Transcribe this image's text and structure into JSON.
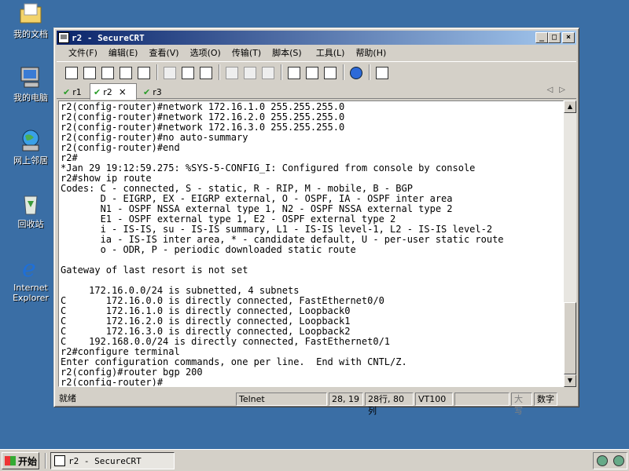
{
  "desktop": {
    "icons": [
      {
        "label": "我的文档"
      },
      {
        "label": "我的电脑"
      },
      {
        "label": "网上邻居"
      },
      {
        "label": "回收站"
      },
      {
        "label": "Internet Explorer"
      }
    ]
  },
  "window": {
    "title": "r2 - SecureCRT",
    "buttons": {
      "minimize": "_",
      "maximize": "□",
      "close": "×"
    }
  },
  "menu": [
    "文件(F)",
    "编辑(E)",
    "查看(V)",
    "选项(O)",
    "传输(T)",
    "脚本(S)",
    "工具(L)",
    "帮助(H)"
  ],
  "tabs": [
    {
      "label": "r1",
      "active": false
    },
    {
      "label": "r2",
      "active": true
    },
    {
      "label": "r3",
      "active": false
    }
  ],
  "tab_close": "×",
  "terminal_lines": [
    "r2(config-router)#network 172.16.1.0 255.255.255.0",
    "r2(config-router)#network 172.16.2.0 255.255.255.0",
    "r2(config-router)#network 172.16.3.0 255.255.255.0",
    "r2(config-router)#no auto-summary",
    "r2(config-router)#end",
    "r2#",
    "*Jan 29 19:12:59.275: %SYS-5-CONFIG_I: Configured from console by console",
    "r2#show ip route",
    "Codes: C - connected, S - static, R - RIP, M - mobile, B - BGP",
    "       D - EIGRP, EX - EIGRP external, O - OSPF, IA - OSPF inter area",
    "       N1 - OSPF NSSA external type 1, N2 - OSPF NSSA external type 2",
    "       E1 - OSPF external type 1, E2 - OSPF external type 2",
    "       i - IS-IS, su - IS-IS summary, L1 - IS-IS level-1, L2 - IS-IS level-2",
    "       ia - IS-IS inter area, * - candidate default, U - per-user static route",
    "       o - ODR, P - periodic downloaded static route",
    "",
    "Gateway of last resort is not set",
    "",
    "     172.16.0.0/24 is subnetted, 4 subnets",
    "C       172.16.0.0 is directly connected, FastEthernet0/0",
    "C       172.16.1.0 is directly connected, Loopback0",
    "C       172.16.2.0 is directly connected, Loopback1",
    "C       172.16.3.0 is directly connected, Loopback2",
    "C    192.168.0.0/24 is directly connected, FastEthernet0/1",
    "r2#configure terminal",
    "Enter configuration commands, one per line.  End with CNTL/Z.",
    "r2(config)#router bgp 200",
    "r2(config-router)#"
  ],
  "status": {
    "ready": "就绪",
    "protocol": "Telnet",
    "cursor": "28, 19",
    "size": "28行, 80列",
    "emulation": "VT100",
    "caps": "大写",
    "num": "数字"
  },
  "taskbar": {
    "start": "开始",
    "task": "r2 - SecureCRT"
  }
}
